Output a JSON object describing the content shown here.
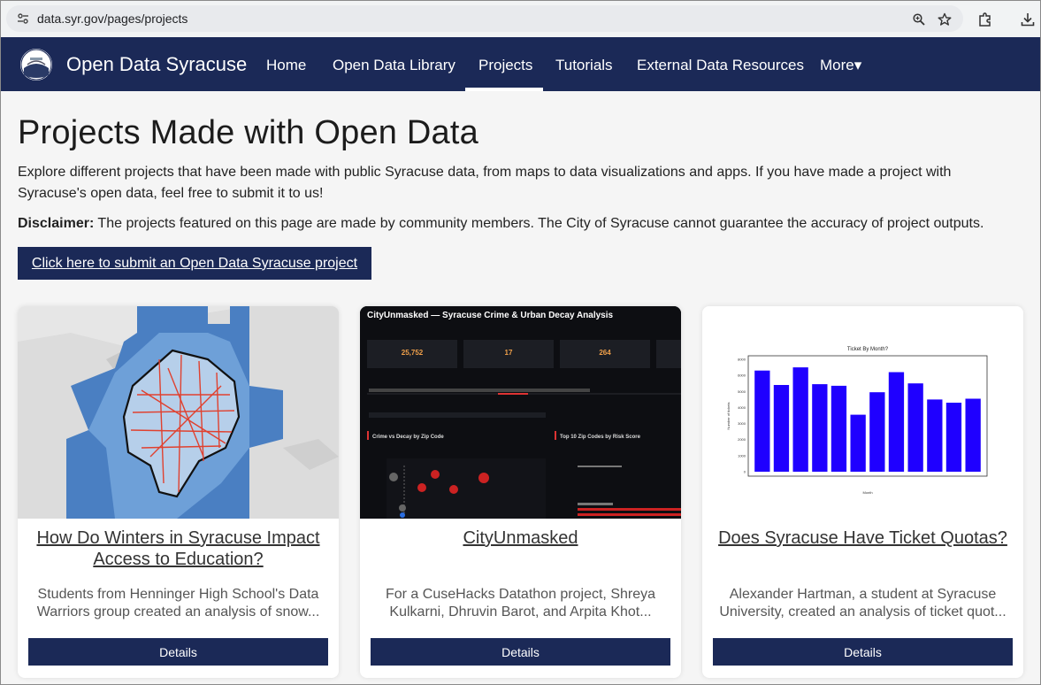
{
  "browser": {
    "url": "data.syr.gov/pages/projects"
  },
  "nav": {
    "site_title": "Open Data Syracuse",
    "items": [
      {
        "label": "Home"
      },
      {
        "label": "Open Data Library"
      },
      {
        "label": "Projects"
      },
      {
        "label": "Tutorials"
      },
      {
        "label": "External Data Resources"
      },
      {
        "label": "More▾"
      }
    ],
    "active": "Projects"
  },
  "page": {
    "title": "Projects Made with Open Data",
    "intro": "Explore different projects that have been made with public Syracuse data, from maps to data visualizations and apps.  If you have made a project with Syracuse's open data, feel free to submit it to us!",
    "disclaimer_label": "Disclaimer:",
    "disclaimer_text": " The projects featured on this page are made by community members.  The City of Syracuse cannot guarantee the accuracy of project outputs.",
    "submit_label": "Click here to submit an Open Data Syracuse project"
  },
  "cards": [
    {
      "title": "How Do Winters in Syracuse Impact Access to Education?",
      "desc_line1": "Students from Henninger High School's Data",
      "desc_line2": "Warriors group created an analysis of snow...",
      "button": "Details"
    },
    {
      "title": "CityUnmasked",
      "desc_line1": "For a CuseHacks Datathon project, Shreya",
      "desc_line2": "Kulkarni, Dhruvin Barot, and Arpita Khot...",
      "button": "Details",
      "thumb": {
        "header": "CityUnmasked — Syracuse Crime & Urban Decay Analysis",
        "kpi1": "25,752",
        "kpi2": "17",
        "kpi3": "264",
        "section1": "Crime vs Decay by Zip Code",
        "section2": "Top 10 Zip Codes by Risk Score"
      }
    },
    {
      "title": "Does Syracuse Have Ticket Quotas?",
      "desc_line1": "Alexander Hartman, a student at Syracuse",
      "desc_line2": "University, created an analysis of ticket quot...",
      "button": "Details",
      "thumb": {
        "title": "Ticket By Month?",
        "ylabel": "Number of tickets",
        "xlabel": "Month",
        "yticks": [
          "8000",
          "6000",
          "5000",
          "4000",
          "3000",
          "2000",
          "1000",
          "0"
        ],
        "values": [
          6300,
          5400,
          6500,
          5450,
          5350,
          3550,
          4950,
          6200,
          5500,
          4500,
          4300,
          4550
        ],
        "ymax": 7000,
        "bar_color": "#1f00ff"
      }
    }
  ],
  "colors": {
    "navy": "#1b2957",
    "bar": "#1f00ff"
  }
}
